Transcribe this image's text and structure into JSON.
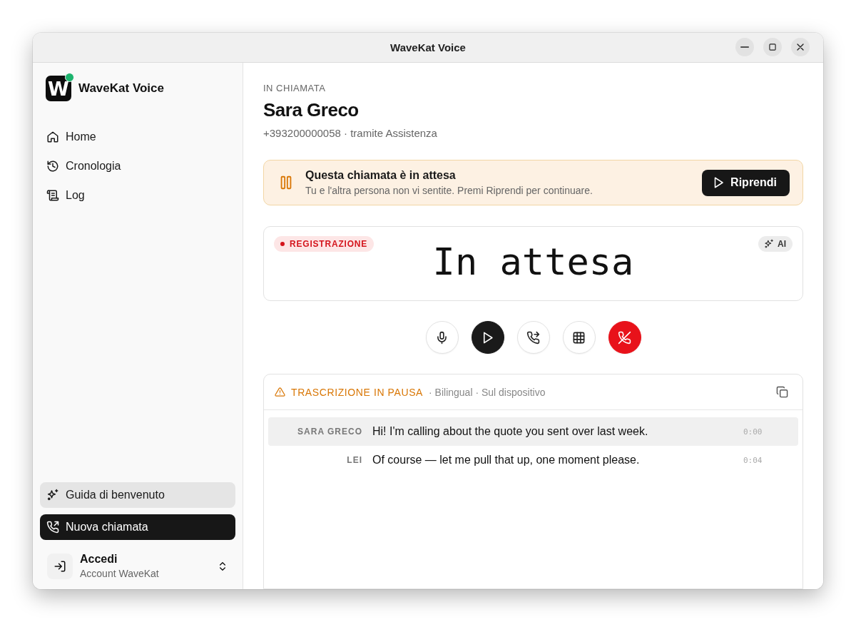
{
  "window": {
    "title": "WaveKat Voice"
  },
  "sidebar": {
    "logo_text": "W",
    "online": true,
    "app_name": "WaveKat Voice",
    "nav": [
      {
        "kind": "home",
        "label": "Home",
        "selected": false
      },
      {
        "kind": "history",
        "label": "Cronologia",
        "selected": false
      },
      {
        "kind": "log",
        "label": "Log",
        "selected": false
      }
    ],
    "actions": [
      {
        "kind": "guide",
        "label": "Guida di benvenuto"
      },
      {
        "kind": "new-call",
        "label": "Nuova chiamata"
      }
    ],
    "account": {
      "title": "Accedi",
      "subtitle": "Account WaveKat"
    }
  },
  "call": {
    "status": "IN CHIAMATA",
    "name": "Sara Greco",
    "subtitle": "+393200000058 · tramite Assistenza"
  },
  "hold_banner": {
    "title": "Questa chiamata è in attesa",
    "message": "Tu e l'altra persona non vi sentite. Premi Riprendi per continuare.",
    "button": "Riprendi"
  },
  "status_card": {
    "recording": true,
    "badge": "REGISTRAZIONE",
    "ai_badge": "AI",
    "display": "In attesa"
  },
  "controls": [
    {
      "kind": "mic"
    },
    {
      "kind": "resume"
    },
    {
      "kind": "transfer"
    },
    {
      "kind": "keypad"
    },
    {
      "kind": "hangup"
    }
  ],
  "transcript": {
    "status": "TRASCRIZIONE IN PAUSA",
    "details": "· Bilingual · Sul dispositivo",
    "rows": [
      {
        "speaker": "SARA GRECO",
        "text": "Hi! I'm calling about the quote you sent over last week.",
        "time": "0:00",
        "selected": true
      },
      {
        "speaker": "LEI",
        "text": "Of course — let me pull that up, one moment please.",
        "time": "0:04",
        "selected": false
      }
    ]
  }
}
